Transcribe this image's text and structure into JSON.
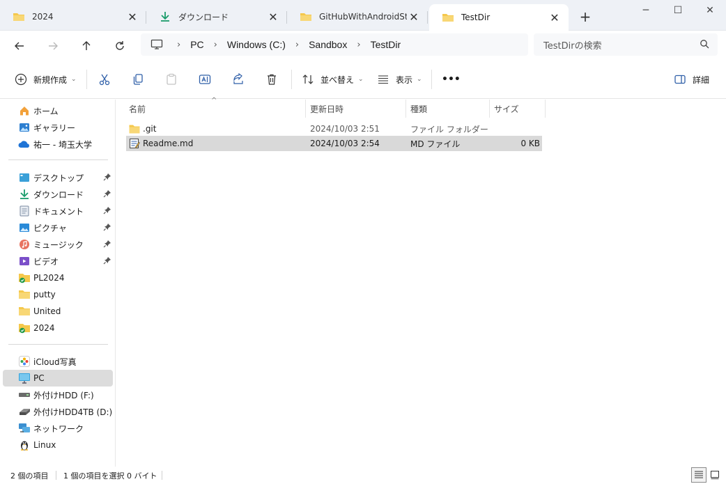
{
  "tabs": [
    {
      "label": "2024",
      "icon": "folder-icon"
    },
    {
      "label": "ダウンロード",
      "icon": "download-icon"
    },
    {
      "label": "GitHubWithAndroidStuc",
      "icon": "folder-icon"
    },
    {
      "label": "TestDir",
      "icon": "folder-icon",
      "active": true
    }
  ],
  "window": {
    "minimize": "─",
    "maximize": "☐",
    "close": "✕",
    "new_tab": "+"
  },
  "address": {
    "root_icon": "computer-icon",
    "crumbs": [
      "PC",
      "Windows (C:)",
      "Sandbox",
      "TestDir"
    ]
  },
  "search": {
    "placeholder": "TestDirの検索"
  },
  "commands": {
    "new": "新規作成",
    "sort": "並べ替え",
    "view": "表示",
    "more": "•••",
    "details": "詳細"
  },
  "sidebar": {
    "quick": [
      {
        "label": "ホーム",
        "icon": "home-icon"
      },
      {
        "label": "ギャラリー",
        "icon": "gallery-icon"
      },
      {
        "label": "祐一 - 埼玉大学",
        "icon": "onedrive-icon"
      }
    ],
    "pinned": [
      {
        "label": "デスクトップ",
        "icon": "desktop-icon"
      },
      {
        "label": "ダウンロード",
        "icon": "download-icon"
      },
      {
        "label": "ドキュメント",
        "icon": "documents-icon"
      },
      {
        "label": "ピクチャ",
        "icon": "pictures-icon"
      },
      {
        "label": "ミュージック",
        "icon": "music-icon"
      },
      {
        "label": "ビデオ",
        "icon": "video-icon"
      }
    ],
    "folders": [
      {
        "label": "PL2024",
        "icon": "sync-folder-icon"
      },
      {
        "label": "putty",
        "icon": "folder-icon"
      },
      {
        "label": "United",
        "icon": "folder-icon"
      },
      {
        "label": "2024",
        "icon": "sync-folder-icon"
      }
    ],
    "devices": [
      {
        "label": "iCloud写真",
        "icon": "icloud-photos-icon"
      },
      {
        "label": "PC",
        "icon": "pc-icon",
        "selected": true
      },
      {
        "label": "外付けHDD (F:)",
        "icon": "drive-icon"
      },
      {
        "label": "外付けHDD4TB (D:)",
        "icon": "drive-icon"
      },
      {
        "label": "ネットワーク",
        "icon": "network-icon"
      },
      {
        "label": "Linux",
        "icon": "linux-icon"
      }
    ]
  },
  "columns": {
    "name": "名前",
    "date": "更新日時",
    "type": "種類",
    "size": "サイズ"
  },
  "files": [
    {
      "name": ".git",
      "date": "2024/10/03 2:51",
      "type": "ファイル フォルダー",
      "size": "",
      "icon": "folder-icon"
    },
    {
      "name": "Readme.md",
      "date": "2024/10/03 2:54",
      "type": "MD ファイル",
      "size": "0 KB",
      "icon": "md-file-icon",
      "selected": true
    }
  ],
  "status": {
    "count": "2 個の項目",
    "selected": "1 個の項目を選択  0 バイト"
  },
  "colors": {
    "folder": "#f5c84c",
    "accent": "#0067c0",
    "selection": "#d9d9d9"
  }
}
